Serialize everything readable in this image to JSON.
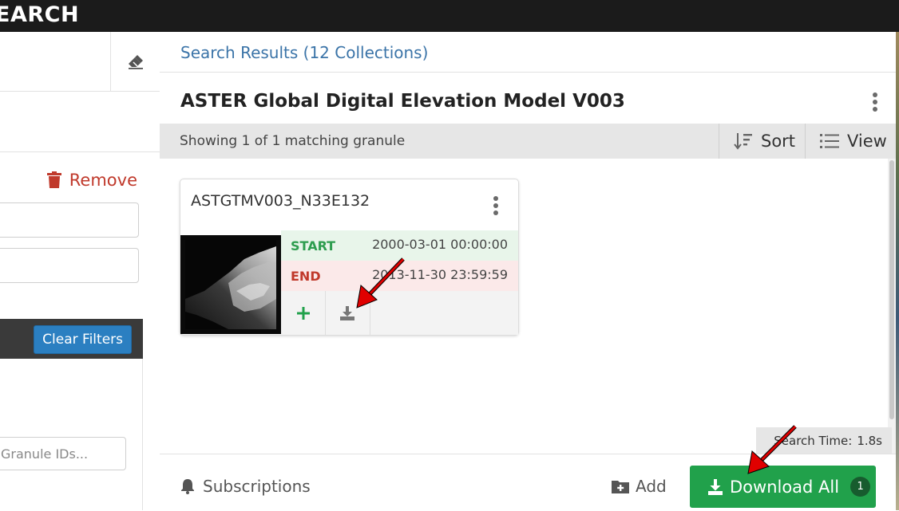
{
  "header": {
    "brand": "EARCH"
  },
  "sidebar": {
    "remove_label": "Remove",
    "clear_filters_label": "Clear Filters",
    "granule_ids_placeholder": "Granule IDs..."
  },
  "results": {
    "title": "Search Results (12 Collections)",
    "collection_title": "ASTER Global Digital Elevation Model V003",
    "showing_text": "Showing 1 of 1 matching granule",
    "sort_label": "Sort",
    "view_label": "View"
  },
  "granule": {
    "name": "ASTGTMV003_N33E132",
    "start_label": "START",
    "start_value": "2000-03-01 00:00:00",
    "end_label": "END",
    "end_value": "2013-11-30 23:59:59"
  },
  "footer": {
    "search_time_label": "Search Time:",
    "search_time_value": "1.8s",
    "subscriptions_label": "Subscriptions",
    "add_label": "Add",
    "download_all_label": "Download All",
    "download_count": "1"
  },
  "colors": {
    "accent_blue": "#3b74a8",
    "download_green": "#21a14b",
    "remove_red": "#c0392b",
    "start_green": "#2e9d4f",
    "end_red": "#c0392b",
    "annotation_arrow": "#e00000"
  },
  "icons": [
    "eraser-icon",
    "trash-icon",
    "sort-icon",
    "list-icon",
    "plus-icon",
    "download-icon",
    "bell-icon",
    "folder-plus-icon",
    "kebab-icon"
  ]
}
